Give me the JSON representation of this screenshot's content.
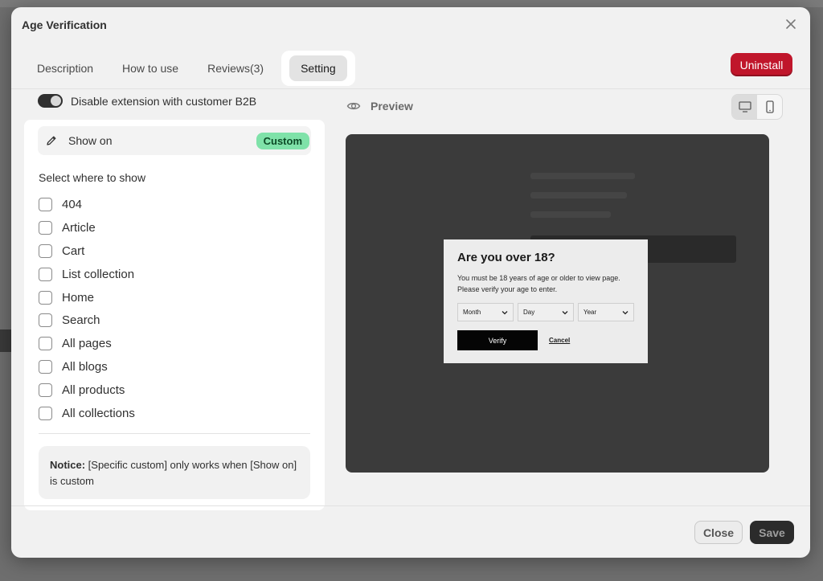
{
  "modal": {
    "title": "Age Verification"
  },
  "tabs": [
    {
      "label": "Description"
    },
    {
      "label": "How to use"
    },
    {
      "label": "Reviews(3)"
    },
    {
      "label": "Setting"
    }
  ],
  "actions": {
    "uninstall": "Uninstall",
    "close": "Close",
    "save": "Save"
  },
  "settings": {
    "b2b_toggle_label": "Disable extension with customer B2B",
    "b2b_toggle_on": true,
    "show_on_label": "Show on",
    "show_on_value": "Custom",
    "select_title": "Select where to show",
    "options": [
      {
        "label": "404",
        "checked": false
      },
      {
        "label": "Article",
        "checked": false
      },
      {
        "label": "Cart",
        "checked": false
      },
      {
        "label": "List collection",
        "checked": false
      },
      {
        "label": "Home",
        "checked": false
      },
      {
        "label": "Search",
        "checked": false
      },
      {
        "label": "All pages",
        "checked": false
      },
      {
        "label": "All blogs",
        "checked": false
      },
      {
        "label": "All products",
        "checked": false
      },
      {
        "label": "All collections",
        "checked": false
      }
    ],
    "notice_label": "Notice:",
    "notice_text": " [Specific custom] only works when [Show on] is custom"
  },
  "preview": {
    "label": "Preview",
    "popup": {
      "title": "Are you over 18?",
      "message": "You must be 18 years of age or older to view page. Please verify your age to enter.",
      "selects": [
        "Month",
        "Day",
        "Year"
      ],
      "verify": "Verify",
      "cancel": "Cancel"
    }
  },
  "colors": {
    "uninstall": "#c0162b",
    "custom_badge": "#7fe2a9",
    "save": "#2b2b2b"
  }
}
